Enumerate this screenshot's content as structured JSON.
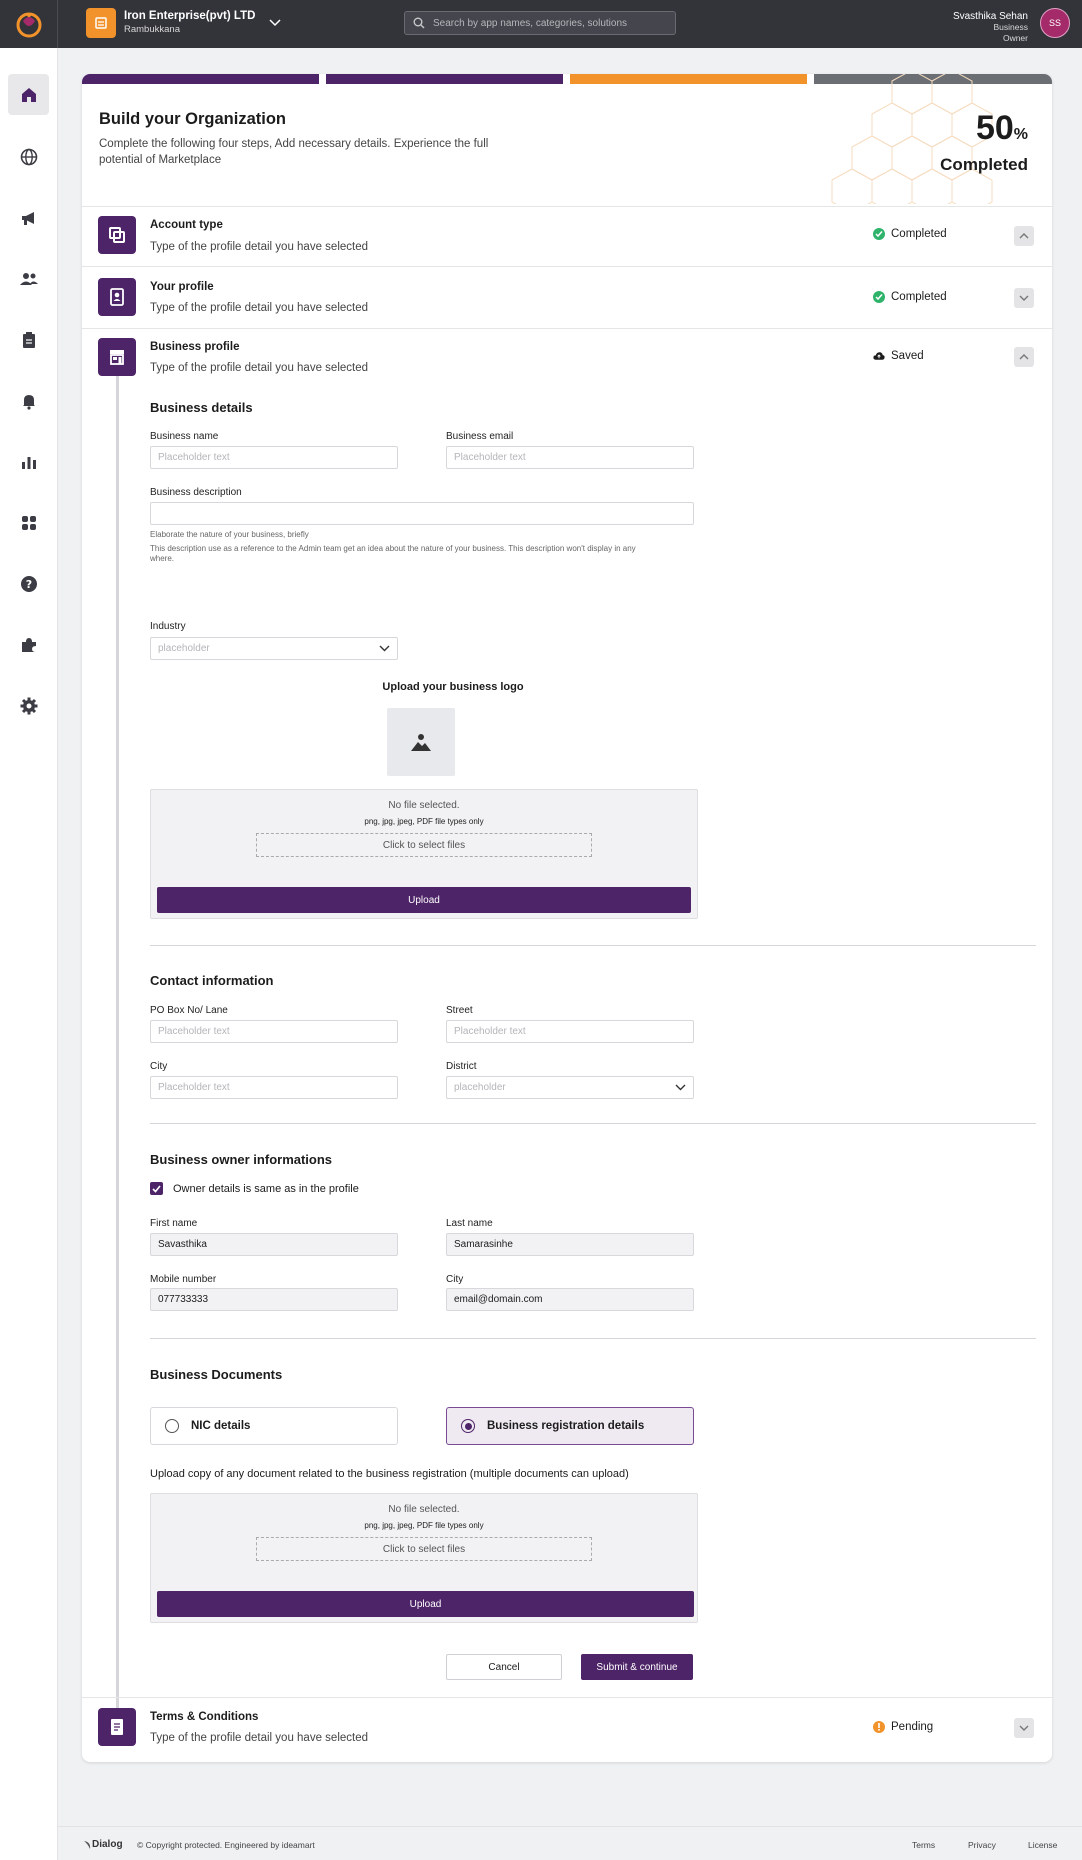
{
  "header": {
    "org_name": "Iron Enterprise(pvt) LTD",
    "org_location": "Rambukkana",
    "search_placeholder": "Search by app names, categories, solutions",
    "user_name": "Svasthika Sehan",
    "user_role_line1": "Business",
    "user_role_line2": "Owner",
    "user_initials": "SS"
  },
  "sidebar": {
    "items": [
      {
        "icon": "home-icon",
        "active": true
      },
      {
        "icon": "globe-icon"
      },
      {
        "icon": "megaphone-icon"
      },
      {
        "icon": "users-icon"
      },
      {
        "icon": "clipboard-icon"
      },
      {
        "icon": "bell-icon"
      },
      {
        "icon": "bar-chart-icon"
      },
      {
        "icon": "apps-icon"
      },
      {
        "icon": "help-icon"
      },
      {
        "icon": "puzzle-icon"
      },
      {
        "icon": "settings-icon"
      }
    ]
  },
  "colors": {
    "brand_purple": "#4e2468",
    "accent_orange": "#f2922a",
    "success_green": "#2fb36b",
    "muted_gray": "#6b6e73"
  },
  "progress": {
    "segments": [
      "completed",
      "completed",
      "in-progress",
      "pending"
    ],
    "percent_value": "50",
    "percent_sign": "%",
    "percent_label": "Completed"
  },
  "hero": {
    "title": "Build your Organization",
    "description": "Complete the following four steps, Add necessary details. Experience the full potential of Marketplace"
  },
  "steps": [
    {
      "title": "Account type",
      "subtitle": "Type of the profile detail you have selected",
      "status": "Completed",
      "icon": "layers-icon"
    },
    {
      "title": "Your profile",
      "subtitle": "Type of the profile detail you have selected",
      "status": "Completed",
      "icon": "id-card-icon"
    },
    {
      "title": "Business profile",
      "subtitle": "Type of the profile detail you have selected",
      "status": "Saved",
      "icon": "store-icon"
    },
    {
      "title": "Terms & Conditions",
      "subtitle": "Type of the profile detail you have selected",
      "status": "Pending",
      "icon": "document-icon"
    }
  ],
  "business_details": {
    "title": "Business details",
    "name_label": "Business name",
    "name_placeholder": "Placeholder text",
    "email_label": "Business email",
    "email_placeholder": "Placeholder text",
    "desc_label": "Business description",
    "desc_help1": "Elaborate the nature of your business, briefly",
    "desc_help2": "This description use as a reference to the Admin team get an idea about the nature of your business. This description won't display in any where.",
    "industry_label": "Industry",
    "industry_placeholder": "placeholder",
    "logo_title": "Upload your business logo"
  },
  "uploader": {
    "no_file": "No file selected.",
    "types": "png, jpg, jpeg, PDF file types only",
    "select": "Click to select files",
    "upload": "Upload"
  },
  "contact": {
    "title": "Contact information",
    "po_label": "PO Box No/ Lane",
    "po_placeholder": "Placeholder text",
    "street_label": "Street",
    "street_placeholder": "Placeholder text",
    "city_label": "City",
    "city_placeholder": "Placeholder text",
    "district_label": "District",
    "district_placeholder": "placeholder"
  },
  "owner": {
    "title": "Business owner informations",
    "same_as_profile": "Owner details is same as in the profile",
    "first_label": "First name",
    "first_value": "Savasthika",
    "last_label": "Last name",
    "last_value": "Samarasinhe",
    "mobile_label": "Mobile number",
    "mobile_value": "077733333",
    "city_label": "City",
    "city_value": "email@domain.com"
  },
  "documents": {
    "title": "Business Documents",
    "option_nic": "NIC details",
    "option_reg": "Business registration details",
    "note": "Upload copy of any document related to the business registration (multiple documents can upload)"
  },
  "actions": {
    "cancel": "Cancel",
    "submit": "Submit & continue"
  },
  "footer": {
    "brand": "Dialog",
    "copyright": "© Copyright protected. Engineered by ideamart",
    "terms": "Terms",
    "privacy": "Privacy",
    "license": "License"
  }
}
